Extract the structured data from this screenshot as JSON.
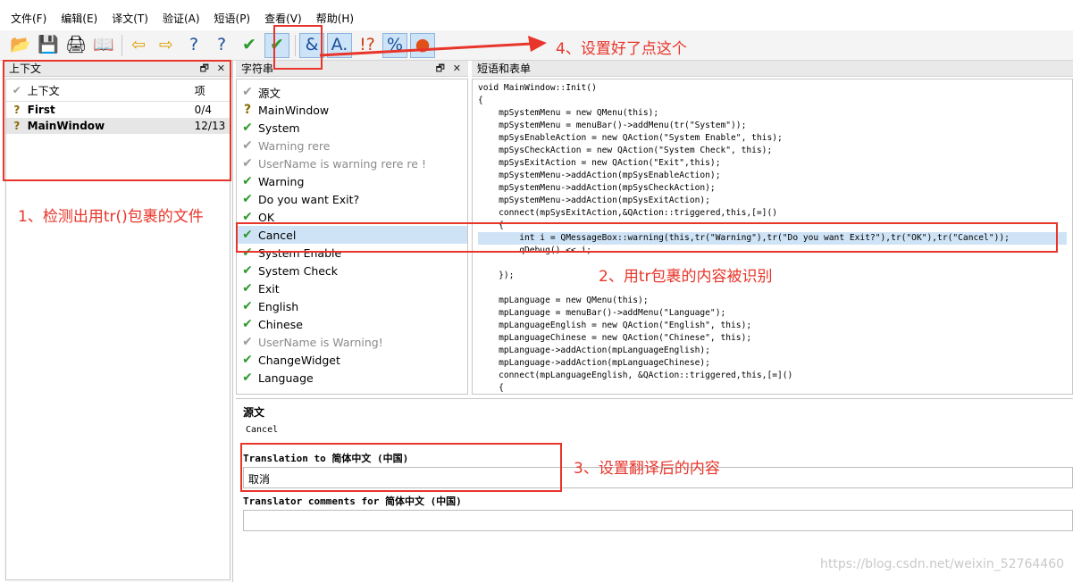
{
  "menu": [
    "文件(F)",
    "编辑(E)",
    "译文(T)",
    "验证(A)",
    "短语(P)",
    "查看(V)",
    "帮助(H)"
  ],
  "toolbar": {
    "buttons": [
      {
        "name": "open-icon",
        "glyph": "📂"
      },
      {
        "name": "save-icon",
        "glyph": "💾"
      },
      {
        "name": "print-icon",
        "glyph": "🖨"
      },
      {
        "name": "phrasebook-icon",
        "glyph": "📖"
      },
      {
        "sep": true
      },
      {
        "name": "prev-icon",
        "glyph": "⇦",
        "color": "#e0a000"
      },
      {
        "name": "next-icon",
        "glyph": "⇨",
        "color": "#e0a000"
      },
      {
        "name": "prev-unfinished-icon",
        "glyph": "?",
        "color": "#1a4f9a"
      },
      {
        "name": "next-unfinished-icon",
        "glyph": "?",
        "color": "#1a4f9a"
      },
      {
        "name": "done-icon",
        "glyph": "✔",
        "color": "#2e9a2e"
      },
      {
        "name": "done-next-icon",
        "glyph": "✔",
        "color": "#2e9a2e",
        "active": true
      },
      {
        "sep": true
      },
      {
        "name": "accelerators-icon",
        "glyph": "&",
        "color": "#1a4f9a",
        "active": true
      },
      {
        "name": "ending-punctuation-icon",
        "glyph": "A.",
        "color": "#1a4f9a",
        "active": true
      },
      {
        "name": "phrase-matches-icon",
        "glyph": "!?",
        "color": "#d04010"
      },
      {
        "name": "place-markers-icon",
        "glyph": "%",
        "color": "#1a4f9a",
        "active": true
      },
      {
        "name": "surrounding-whitespace-icon",
        "glyph": "●",
        "color": "#e0501a",
        "active": true
      }
    ]
  },
  "context_dock": {
    "title": "上下文",
    "float": "🗗",
    "close": "✕",
    "header": {
      "icon": "✔",
      "name": "上下文",
      "count": "项"
    },
    "rows": [
      {
        "icon": "?",
        "name": "First",
        "count": "0/4"
      },
      {
        "icon": "?",
        "name": "MainWindow",
        "count": "12/13"
      }
    ]
  },
  "strings_dock": {
    "title": "字符串",
    "float": "🗗",
    "close": "✕",
    "items": [
      {
        "icon": "✔",
        "style": "gray",
        "text": "源文"
      },
      {
        "icon": "?",
        "style": "q",
        "text": "MainWindow"
      },
      {
        "icon": "✔",
        "style": "ok",
        "text": "System"
      },
      {
        "icon": "✔",
        "style": "gray",
        "text": "Warning rere",
        "gray": true
      },
      {
        "icon": "✔",
        "style": "gray",
        "text": "UserName is warning rere re !",
        "gray": true
      },
      {
        "icon": "✔",
        "style": "ok",
        "text": "Warning"
      },
      {
        "icon": "✔",
        "style": "ok",
        "text": "Do you want Exit?"
      },
      {
        "icon": "✔",
        "style": "ok",
        "text": "OK"
      },
      {
        "icon": "✔",
        "style": "ok",
        "text": "Cancel",
        "selected": true
      },
      {
        "icon": "✔",
        "style": "ok",
        "text": "System Enable"
      },
      {
        "icon": "✔",
        "style": "ok",
        "text": "System Check"
      },
      {
        "icon": "✔",
        "style": "ok",
        "text": "Exit"
      },
      {
        "icon": "✔",
        "style": "ok",
        "text": "English"
      },
      {
        "icon": "✔",
        "style": "ok",
        "text": "Chinese"
      },
      {
        "icon": "✔",
        "style": "gray",
        "text": "UserName is Warning!",
        "gray": true
      },
      {
        "icon": "✔",
        "style": "ok",
        "text": "ChangeWidget"
      },
      {
        "icon": "✔",
        "style": "ok",
        "text": "Language"
      }
    ]
  },
  "code_dock": {
    "title": "短语和表单",
    "lines": [
      "void MainWindow::Init()",
      "{",
      "    mpSystemMenu = new QMenu(this);",
      "    mpSystemMenu = menuBar()->addMenu(tr(\"System\"));",
      "    mpSysEnableAction = new QAction(\"System Enable\", this);",
      "    mpSysCheckAction = new QAction(\"System Check\", this);",
      "    mpSysExitAction = new QAction(\"Exit\",this);",
      "    mpSystemMenu->addAction(mpSysEnableAction);",
      "    mpSystemMenu->addAction(mpSysCheckAction);",
      "    mpSystemMenu->addAction(mpSysExitAction);",
      "    connect(mpSysExitAction,&QAction::triggered,this,[=]()",
      "    {",
      "        int i = QMessageBox::warning(this,tr(\"Warning\"),tr(\"Do you want Exit?\"),tr(\"OK\"),tr(\"Cancel\"));",
      "        qDebug() << i;",
      "",
      "    });",
      "",
      "    mpLanguage = new QMenu(this);",
      "    mpLanguage = menuBar()->addMenu(\"Language\");",
      "    mpLanguageEnglish = new QAction(\"English\", this);",
      "    mpLanguageChinese = new QAction(\"Chinese\", this);",
      "    mpLanguage->addAction(mpLanguageEnglish);",
      "    mpLanguage->addAction(mpLanguageChinese);",
      "    connect(mpLanguageEnglish, &QAction::triggered,this,[=]()",
      "    {"
    ],
    "highlight_index": 12
  },
  "editor": {
    "source_label": "源文",
    "source_text": "Cancel",
    "translation_label": "Translation to 简体中文 (中国)",
    "translation_value": "取消",
    "comments_label": "Translator comments for 简体中文 (中国)",
    "comments_value": ""
  },
  "annotations": {
    "a1": "1、检测出用tr()包裹的文件",
    "a2": "2、用tr包裹的内容被识别",
    "a3": "3、设置翻译后的内容",
    "a4": "4、设置好了点这个",
    "accent": "#e8352a"
  },
  "watermark": "https://blog.csdn.net/weixin_52764460"
}
